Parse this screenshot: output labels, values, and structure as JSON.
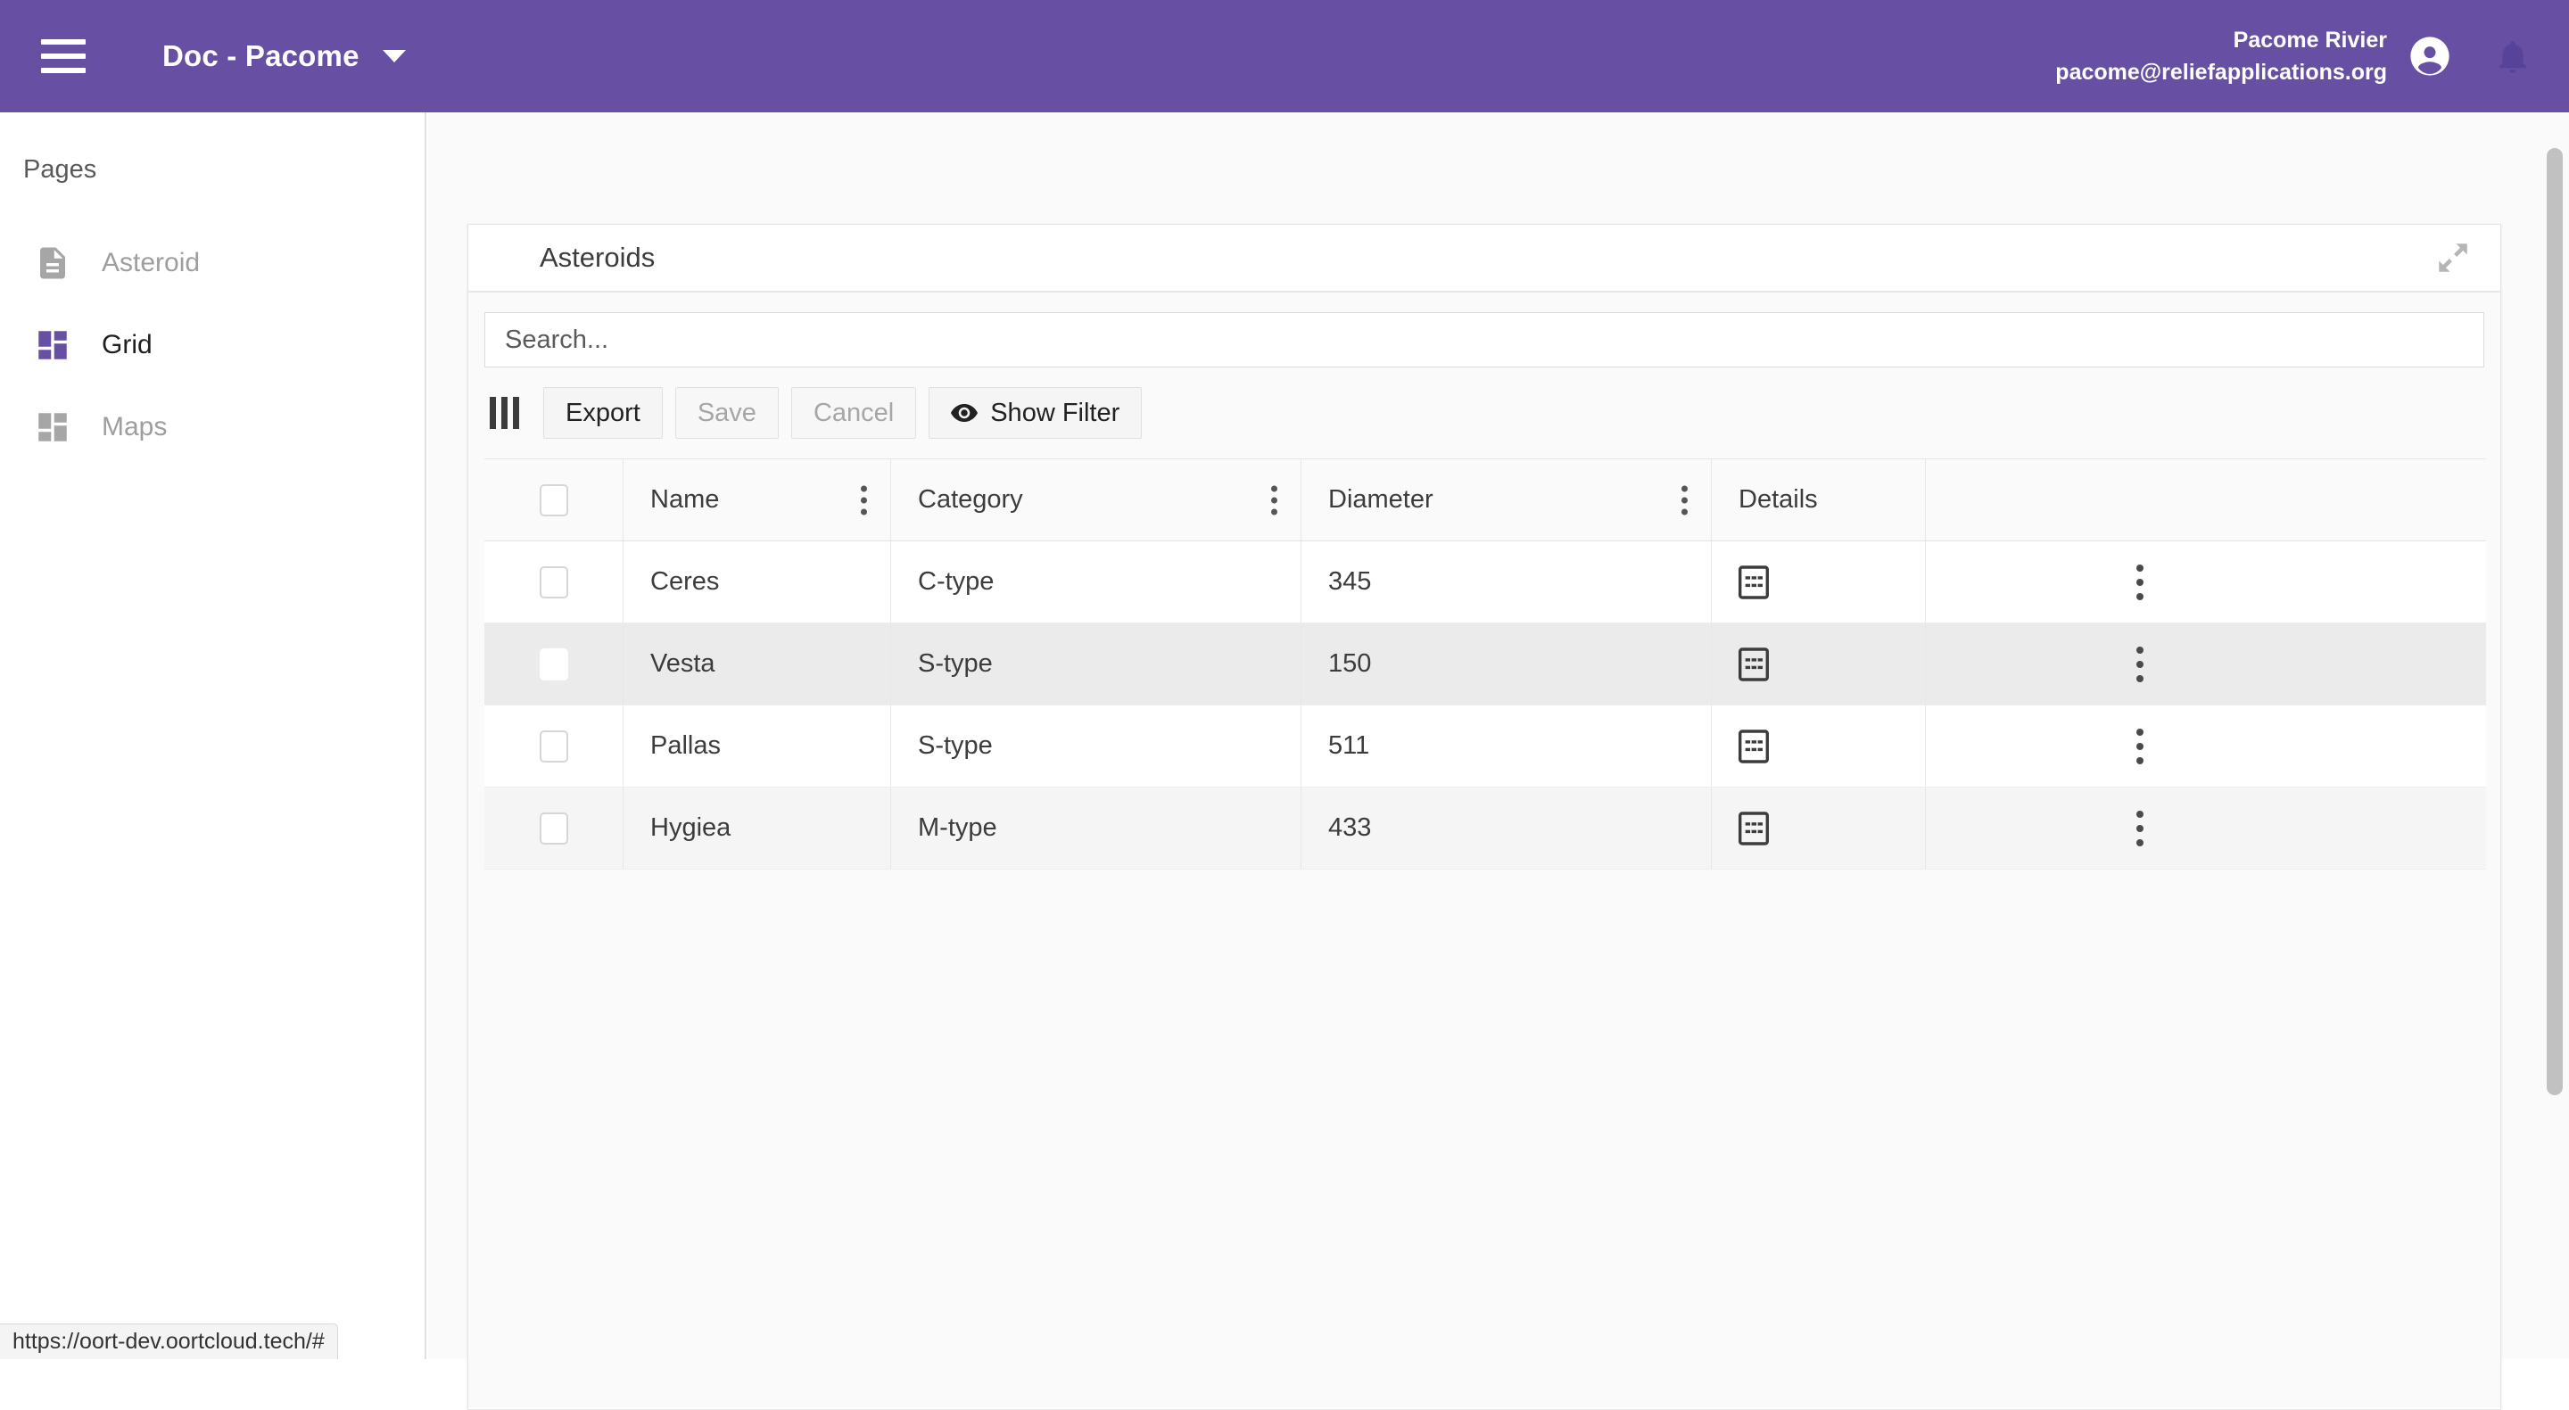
{
  "topbar": {
    "menu_icon": "hamburger-menu-icon",
    "app_title": "Doc - Pacome",
    "caret_icon": "chevron-down-icon",
    "user_name": "Pacome Rivier",
    "user_email": "pacome@reliefapplications.org",
    "account_icon": "account-circle-icon",
    "notification_icon": "bell-icon",
    "background_color": "#6750a4"
  },
  "sidebar": {
    "section_label": "Pages",
    "items": [
      {
        "label": "Asteroid",
        "icon": "document-icon",
        "active": false
      },
      {
        "label": "Grid",
        "icon": "dashboard-icon",
        "active": true
      },
      {
        "label": "Maps",
        "icon": "dashboard-icon",
        "active": false
      }
    ],
    "active_color": "#6750a4",
    "inactive_color": "#9e9e9e"
  },
  "widget": {
    "title": "Asteroids",
    "expand_icon": "expand-fullscreen-icon"
  },
  "search": {
    "placeholder": "Search...",
    "value": ""
  },
  "toolbar": {
    "columns_icon": "columns-icon",
    "export_label": "Export",
    "save_label": "Save",
    "save_disabled": true,
    "cancel_label": "Cancel",
    "cancel_disabled": true,
    "show_filter_label": "Show Filter",
    "show_filter_icon": "eye-icon"
  },
  "table": {
    "select_all_checkbox": false,
    "columns": [
      {
        "key": "name",
        "label": "Name",
        "menu": true
      },
      {
        "key": "category",
        "label": "Category",
        "menu": true
      },
      {
        "key": "diameter",
        "label": "Diameter",
        "menu": true
      },
      {
        "key": "details",
        "label": "Details",
        "menu": false
      }
    ],
    "column_menu_icon": "more-vertical-icon",
    "row_detail_icon": "details-view-icon",
    "row_action_icon": "more-vertical-icon",
    "rows": [
      {
        "checked": false,
        "name": "Ceres",
        "category": "C-type",
        "diameter": "345",
        "state": "normal"
      },
      {
        "checked": false,
        "name": "Vesta",
        "category": "S-type",
        "diameter": "150",
        "state": "hover"
      },
      {
        "checked": false,
        "name": "Pallas",
        "category": "S-type",
        "diameter": "511",
        "state": "normal"
      },
      {
        "checked": false,
        "name": "Hygiea",
        "category": "M-type",
        "diameter": "433",
        "state": "alt"
      }
    ]
  },
  "statusbar": {
    "url": "https://oort-dev.oortcloud.tech/#"
  }
}
